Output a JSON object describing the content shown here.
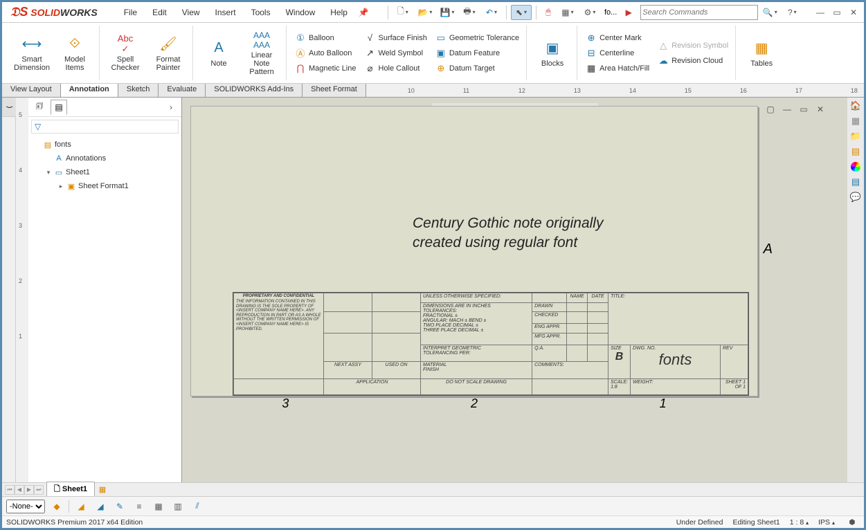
{
  "app": {
    "logo_s": "S",
    "logo_solid": "SOLID",
    "logo_works": "WORKS"
  },
  "menu": [
    "File",
    "Edit",
    "View",
    "Insert",
    "Tools",
    "Window",
    "Help"
  ],
  "qat_doc": "fo...",
  "search_placeholder": "Search Commands",
  "ribbon": {
    "big": {
      "smart_dim": "Smart\nDimension",
      "model_items": "Model\nItems",
      "spell": "Spell\nChecker",
      "fmt": "Format\nPainter",
      "note": "Note",
      "lnp": "Linear Note\nPattern",
      "blocks": "Blocks",
      "tables": "Tables"
    },
    "col1": [
      "Balloon",
      "Auto Balloon",
      "Magnetic Line"
    ],
    "col2": [
      "Surface Finish",
      "Weld Symbol",
      "Hole Callout"
    ],
    "col3": [
      "Geometric Tolerance",
      "Datum Feature",
      "Datum Target"
    ],
    "col4": [
      "Center Mark",
      "Centerline",
      "Area Hatch/Fill"
    ],
    "col5": [
      "Revision Symbol",
      "Revision Cloud"
    ]
  },
  "tabs": [
    "View Layout",
    "Annotation",
    "Sketch",
    "Evaluate",
    "SOLIDWORKS Add-Ins",
    "Sheet Format"
  ],
  "ruler_h": [
    "10",
    "11",
    "12",
    "13",
    "14",
    "15",
    "16",
    "17",
    "18"
  ],
  "ruler_v": [
    "5",
    "4",
    "3",
    "2",
    "1"
  ],
  "tree": {
    "root": "fonts",
    "ann": "Annotations",
    "sheet": "Sheet1",
    "sheetfmt": "Sheet Format1"
  },
  "note_line1": "Century Gothic note originally",
  "note_line2": "created using regular font",
  "tb": {
    "spec": "UNLESS OTHERWISE SPECIFIED:",
    "dims": "DIMENSIONS ARE IN INCHES",
    "tol": "TOLERANCES:",
    "frac": "FRACTIONAL ±",
    "ang": "ANGULAR: MACH ±   BEND ±",
    "two": "TWO PLACE DECIMAL   ±",
    "three": "THREE PLACE DECIMAL ±",
    "interp": "INTERPRET GEOMETRIC",
    "tolper": "TOLERANCING PER:",
    "mat": "MATERIAL",
    "fin": "FINISH",
    "dnsd": "DO NOT SCALE DRAWING",
    "name": "NAME",
    "date": "DATE",
    "drawn": "DRAWN",
    "checked": "CHECKED",
    "engappr": "ENG APPR.",
    "mfgappr": "MFG APPR.",
    "qa": "Q.A.",
    "comments": "COMMENTS:",
    "prop": "PROPRIETARY AND CONFIDENTIAL",
    "propbody": "THE INFORMATION CONTAINED IN THIS DRAWING IS THE SOLE PROPERTY OF <INSERT COMPANY NAME HERE>.  ANY REPRODUCTION IN PART OR AS A WHOLE WITHOUT THE WRITTEN PERMISSION OF <INSERT COMPANY NAME HERE> IS PROHIBITED.",
    "nextassy": "NEXT ASSY",
    "usedon": "USED ON",
    "app": "APPLICATION",
    "title_lbl": "TITLE:",
    "size_lbl": "SIZE",
    "size": "B",
    "dwgno_lbl": "DWG.  NO.",
    "dwgno": "fonts",
    "rev_lbl": "REV",
    "scale": "SCALE: 1:8",
    "weight": "WEIGHT:",
    "sheet": "SHEET 1 OF 1"
  },
  "axis_a": "A",
  "zones": [
    "3",
    "2",
    "1"
  ],
  "sheet_tab": "Sheet1",
  "bottom_sel": "-None-",
  "status": {
    "edition": "SOLIDWORKS Premium 2017 x64 Edition",
    "def": "Under Defined",
    "edit": "Editing Sheet1",
    "scale": "1 : 8",
    "units": "IPS"
  }
}
